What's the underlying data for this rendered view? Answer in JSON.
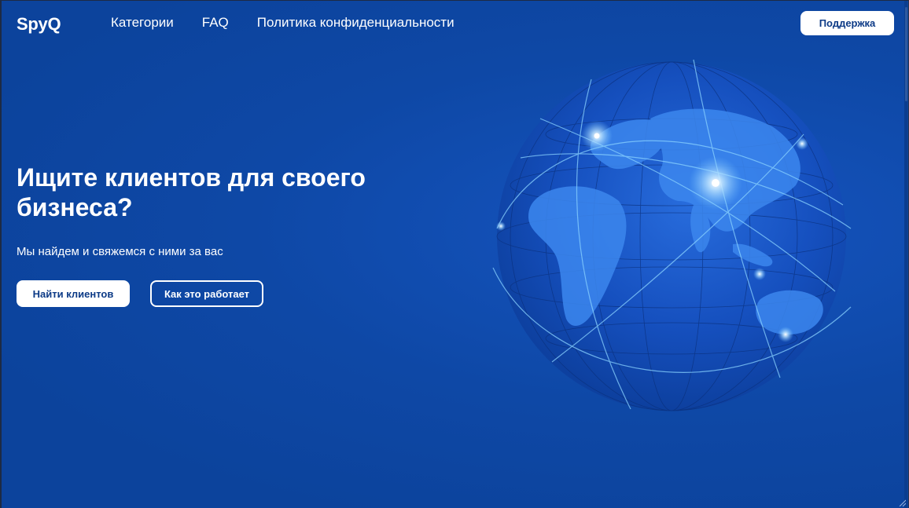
{
  "header": {
    "logo": "SpyQ",
    "nav": [
      {
        "label": "Категории"
      },
      {
        "label": "FAQ"
      },
      {
        "label": "Политика конфиденциальности"
      }
    ],
    "support_label": "Поддержка"
  },
  "hero": {
    "title": "Ищите клиентов для своего бизнеса?",
    "subtitle": "Мы найдем и свяжемся с ними за вас",
    "primary_label": "Найти клиентов",
    "secondary_label": "Как это работает"
  },
  "colors": {
    "background": "#0c439c",
    "globe": "#1a5ad0",
    "continent": "#3c87ee",
    "button_bg": "#ffffff",
    "button_text": "#0c3a86"
  },
  "icons": {
    "globe": "globe-illustration",
    "resize": "resize-grip-icon"
  }
}
